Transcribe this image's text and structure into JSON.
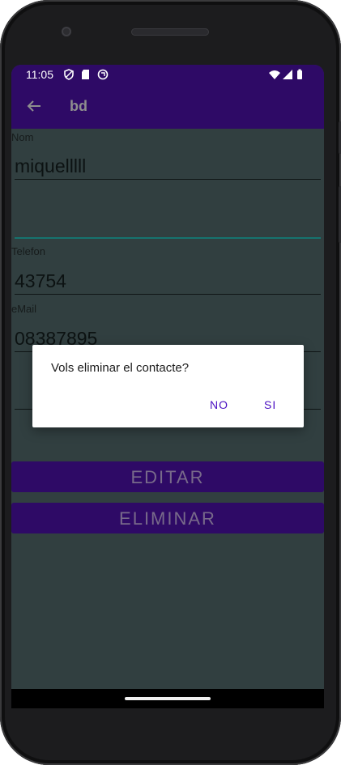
{
  "status_bar": {
    "time": "11:05",
    "left_icons": [
      "shield-icon",
      "sd-card-icon",
      "sync-icon"
    ],
    "right_icons": [
      "wifi-icon",
      "signal-icon",
      "battery-icon"
    ]
  },
  "app_bar": {
    "title": "bd",
    "back_icon": "arrow-back-icon"
  },
  "form": {
    "nom_label": "Nom",
    "nom_value": "miquelllll",
    "telefon_label": "Telefon",
    "telefon_value": "43754",
    "email_label": "eMail",
    "email_value": "08387895"
  },
  "buttons": {
    "edit_label": "EDITAR",
    "delete_label": "ELIMINAR"
  },
  "dialog": {
    "message": "Vols eliminar el contacte?",
    "no_label": "NO",
    "yes_label": "SI"
  },
  "colors": {
    "primary": "#2e0a66",
    "background": "#313f40",
    "accent": "#4a0fc2"
  }
}
